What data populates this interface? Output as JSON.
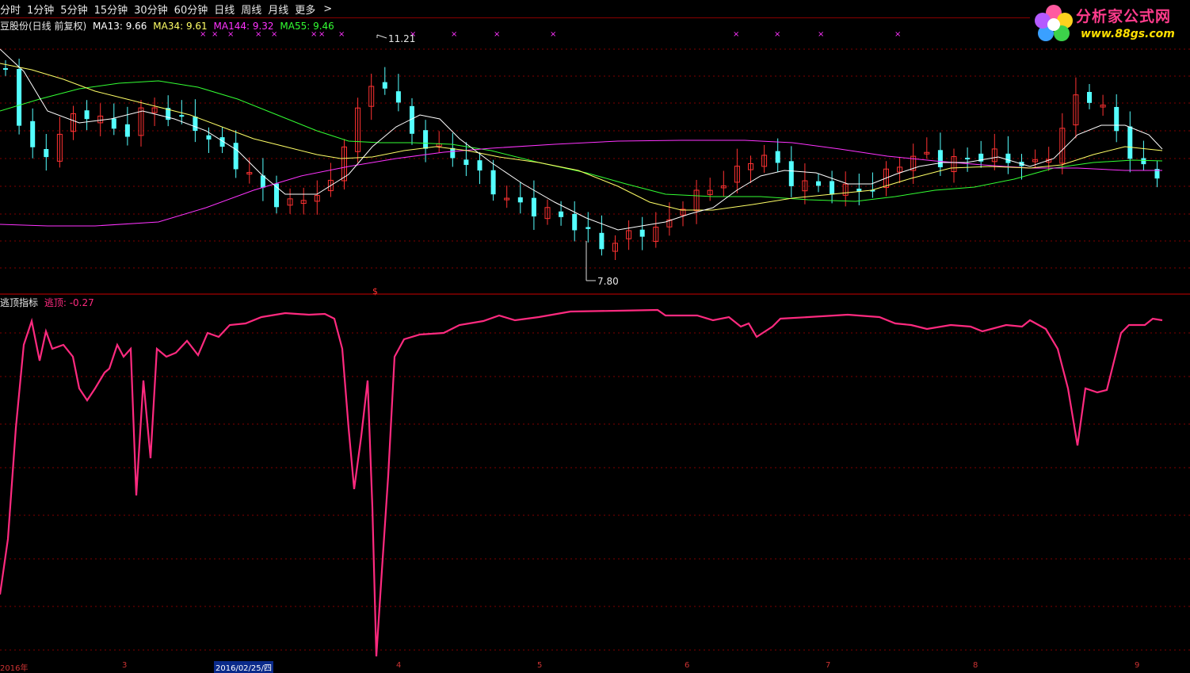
{
  "toolbar": {
    "items": [
      "分时",
      "1分钟",
      "5分钟",
      "15分钟",
      "30分钟",
      "60分钟",
      "日线",
      "周线",
      "月线",
      "更多"
    ],
    "more_arrow": ">"
  },
  "main_chart": {
    "title": "豆股份(日线 前复权)",
    "ma": [
      {
        "label": "MA13: 9.66",
        "color": "#ffffff"
      },
      {
        "label": "MA34: 9.61",
        "color": "#ffff66"
      },
      {
        "label": "MA144: 9.32",
        "color": "#ff33ff"
      },
      {
        "label": "MA55: 9.46",
        "color": "#33ff33"
      }
    ],
    "high_label": "11.21",
    "low_label": "7.80",
    "marker_symbol": "×",
    "signal_symbol": "$"
  },
  "indicator": {
    "name": "逃顶指标",
    "series_label": "逃顶: -0.27",
    "name_color": "#e8e8e8",
    "series_color": "#ff2a7f"
  },
  "logo": {
    "text": "分析家公式网",
    "url": "www.88gs.com"
  },
  "xaxis": {
    "labels": [
      "2016年",
      "3",
      "2016/02/25/四",
      "4",
      "5",
      "6",
      "7",
      "8",
      "9"
    ]
  },
  "colors": {
    "up": "#ff3232",
    "down": "#54ffff",
    "grid": "#800000",
    "border": "#cc0000"
  },
  "chart_data": [
    {
      "type": "candlestick",
      "title": "豆股份(日线 前复权)",
      "series": [
        {
          "name": "MA13",
          "values": [],
          "color": "#ffffff"
        },
        {
          "name": "MA34",
          "values": [],
          "color": "#ffff66"
        },
        {
          "name": "MA144",
          "values": [],
          "color": "#ff33ff"
        },
        {
          "name": "MA55",
          "values": [],
          "color": "#33ff33"
        }
      ],
      "extremes": {
        "high": 11.21,
        "low": 7.8
      }
    },
    {
      "type": "line",
      "title": "逃顶指标",
      "series": [
        {
          "name": "逃顶",
          "last_value": -0.27
        }
      ]
    }
  ]
}
